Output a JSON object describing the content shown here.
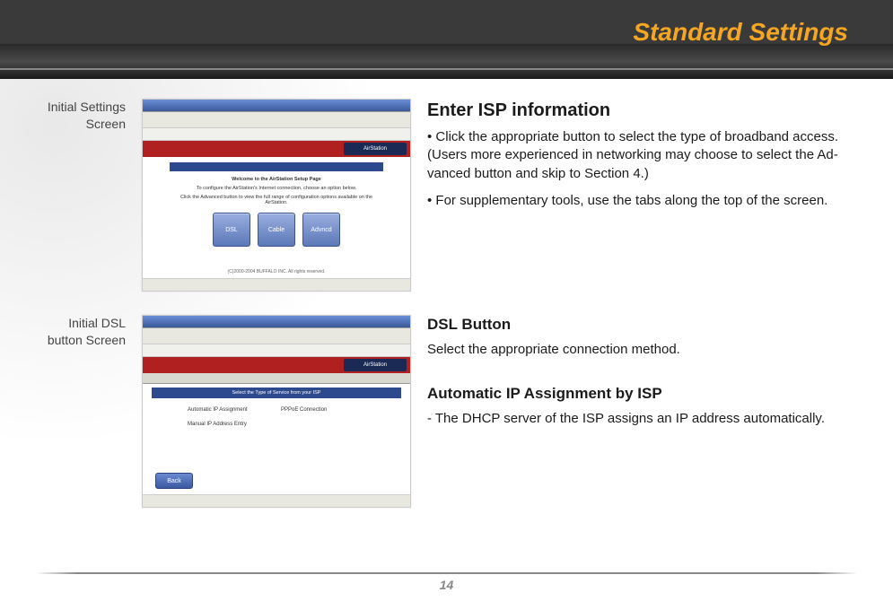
{
  "header": {
    "title": "Standard Settings"
  },
  "captions": {
    "thumb1": "Initial Settings Screen",
    "thumb2": "Initial DSL button Screen"
  },
  "screenshot1": {
    "brand_right": "AirStation",
    "welcome_title": "Welcome to the AirStation Setup Page",
    "welcome_line1": "To configure the AirStation's Internet connection, choose an option below.",
    "welcome_line2": "Click the Advanced button to view the full range of configuration options available on the AirStation.",
    "btn_dsl": "DSL",
    "btn_cable": "Cable",
    "btn_adv": "Advncd",
    "copyright": "(C)2000-2004 BUFFALO INC. All rights reserved."
  },
  "screenshot2": {
    "brand_right": "AirStation",
    "blue_title": "Select the Type of Service from your ISP",
    "opt1": "Automatic IP Assignment",
    "opt2": "PPPoE Connection",
    "opt3": "Manual IP Address Entry",
    "back": "Back"
  },
  "section1": {
    "heading": "Enter ISP information",
    "bullet1": "• Click the appropriate button to select the type of broadband access.  (Users more experienced in networking may choose to select the Ad­vanced button and skip to Section 4.)",
    "bullet2": "• For supplementary tools, use the tabs along the top of the screen."
  },
  "section2": {
    "heading": "DSL Button",
    "body": "Select the appropriate connection method."
  },
  "section3": {
    "heading": "Automatic IP Assignment by ISP",
    "body": "- The DHCP server of the ISP assigns an IP ad­dress automatically."
  },
  "footer": {
    "page": "14"
  }
}
